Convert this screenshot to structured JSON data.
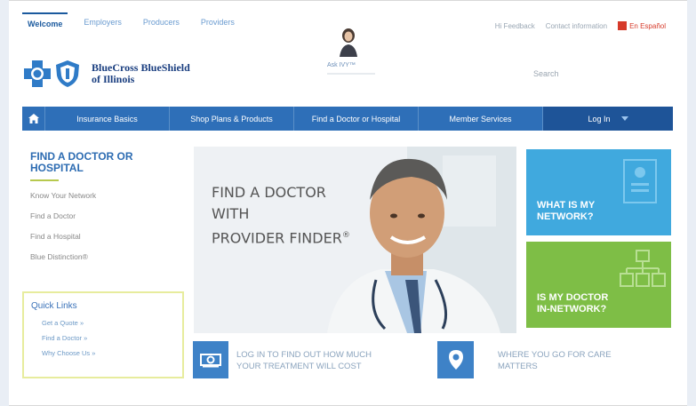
{
  "top_tabs": [
    "Welcome",
    "Employers",
    "Producers",
    "Providers"
  ],
  "top_right": {
    "link1": "Hi Feedback",
    "link2": "Contact information",
    "espanol": "En Español"
  },
  "logo": {
    "line1": "BlueCross BlueShield",
    "line2": "of Illinois"
  },
  "promo": {
    "caption": "Ask IVY™"
  },
  "search": {
    "placeholder": "Search"
  },
  "nav": {
    "items": [
      "Insurance Basics",
      "Shop Plans & Products",
      "Find a Doctor or Hospital",
      "Member Services"
    ],
    "login": "Log In"
  },
  "sidebar": {
    "title": "FIND A DOCTOR OR HOSPITAL",
    "links": [
      "Know Your Network",
      "Find a Doctor",
      "Find a Hospital",
      "Blue Distinction®"
    ],
    "quick_links_title": "Quick Links",
    "quick_links": [
      "Get a Quote »",
      "Find a Doctor »",
      "Why Choose Us »"
    ]
  },
  "hero": {
    "line1": "FIND A DOCTOR",
    "line2": "WITH",
    "line3": "PROVIDER FINDER",
    "reg": "®"
  },
  "tiles": {
    "blue": {
      "line1": "WHAT IS MY",
      "line2": "NETWORK?",
      "color": "#40a9de"
    },
    "green": {
      "line1": "IS MY DOCTOR",
      "line2": "IN-NETWORK?",
      "color": "#7ebe46"
    }
  },
  "bottom": {
    "left": {
      "line1": "LOG IN TO FIND OUT HOW MUCH",
      "line2": "YOUR TREATMENT WILL COST",
      "icon": "money-icon"
    },
    "right": {
      "line1": "WHERE YOU GO FOR CARE",
      "line2": "MATTERS",
      "icon": "location-pin-icon"
    }
  },
  "colors": {
    "nav": "#2e6fb8",
    "title": "#2d6cb2",
    "accent_green": "#b7c94e"
  }
}
